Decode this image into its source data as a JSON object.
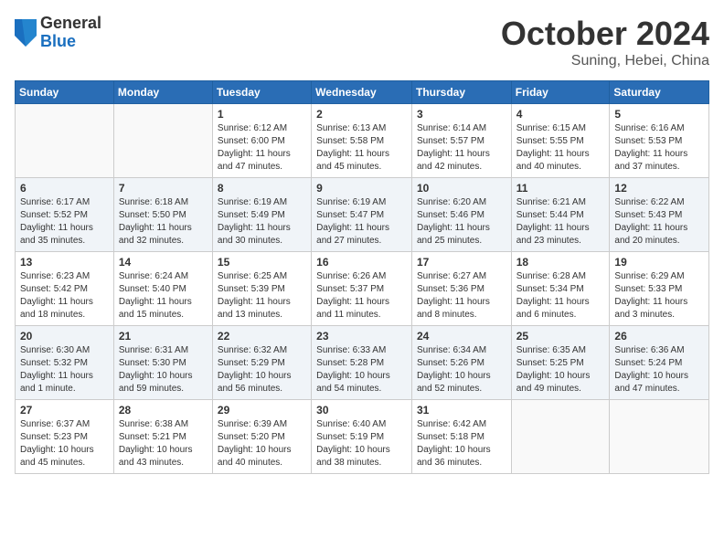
{
  "header": {
    "logo_general": "General",
    "logo_blue": "Blue",
    "month": "October 2024",
    "location": "Suning, Hebei, China"
  },
  "weekdays": [
    "Sunday",
    "Monday",
    "Tuesday",
    "Wednesday",
    "Thursday",
    "Friday",
    "Saturday"
  ],
  "weeks": [
    [
      {
        "day": "",
        "content": ""
      },
      {
        "day": "",
        "content": ""
      },
      {
        "day": "1",
        "content": "Sunrise: 6:12 AM\nSunset: 6:00 PM\nDaylight: 11 hours and 47 minutes."
      },
      {
        "day": "2",
        "content": "Sunrise: 6:13 AM\nSunset: 5:58 PM\nDaylight: 11 hours and 45 minutes."
      },
      {
        "day": "3",
        "content": "Sunrise: 6:14 AM\nSunset: 5:57 PM\nDaylight: 11 hours and 42 minutes."
      },
      {
        "day": "4",
        "content": "Sunrise: 6:15 AM\nSunset: 5:55 PM\nDaylight: 11 hours and 40 minutes."
      },
      {
        "day": "5",
        "content": "Sunrise: 6:16 AM\nSunset: 5:53 PM\nDaylight: 11 hours and 37 minutes."
      }
    ],
    [
      {
        "day": "6",
        "content": "Sunrise: 6:17 AM\nSunset: 5:52 PM\nDaylight: 11 hours and 35 minutes."
      },
      {
        "day": "7",
        "content": "Sunrise: 6:18 AM\nSunset: 5:50 PM\nDaylight: 11 hours and 32 minutes."
      },
      {
        "day": "8",
        "content": "Sunrise: 6:19 AM\nSunset: 5:49 PM\nDaylight: 11 hours and 30 minutes."
      },
      {
        "day": "9",
        "content": "Sunrise: 6:19 AM\nSunset: 5:47 PM\nDaylight: 11 hours and 27 minutes."
      },
      {
        "day": "10",
        "content": "Sunrise: 6:20 AM\nSunset: 5:46 PM\nDaylight: 11 hours and 25 minutes."
      },
      {
        "day": "11",
        "content": "Sunrise: 6:21 AM\nSunset: 5:44 PM\nDaylight: 11 hours and 23 minutes."
      },
      {
        "day": "12",
        "content": "Sunrise: 6:22 AM\nSunset: 5:43 PM\nDaylight: 11 hours and 20 minutes."
      }
    ],
    [
      {
        "day": "13",
        "content": "Sunrise: 6:23 AM\nSunset: 5:42 PM\nDaylight: 11 hours and 18 minutes."
      },
      {
        "day": "14",
        "content": "Sunrise: 6:24 AM\nSunset: 5:40 PM\nDaylight: 11 hours and 15 minutes."
      },
      {
        "day": "15",
        "content": "Sunrise: 6:25 AM\nSunset: 5:39 PM\nDaylight: 11 hours and 13 minutes."
      },
      {
        "day": "16",
        "content": "Sunrise: 6:26 AM\nSunset: 5:37 PM\nDaylight: 11 hours and 11 minutes."
      },
      {
        "day": "17",
        "content": "Sunrise: 6:27 AM\nSunset: 5:36 PM\nDaylight: 11 hours and 8 minutes."
      },
      {
        "day": "18",
        "content": "Sunrise: 6:28 AM\nSunset: 5:34 PM\nDaylight: 11 hours and 6 minutes."
      },
      {
        "day": "19",
        "content": "Sunrise: 6:29 AM\nSunset: 5:33 PM\nDaylight: 11 hours and 3 minutes."
      }
    ],
    [
      {
        "day": "20",
        "content": "Sunrise: 6:30 AM\nSunset: 5:32 PM\nDaylight: 11 hours and 1 minute."
      },
      {
        "day": "21",
        "content": "Sunrise: 6:31 AM\nSunset: 5:30 PM\nDaylight: 10 hours and 59 minutes."
      },
      {
        "day": "22",
        "content": "Sunrise: 6:32 AM\nSunset: 5:29 PM\nDaylight: 10 hours and 56 minutes."
      },
      {
        "day": "23",
        "content": "Sunrise: 6:33 AM\nSunset: 5:28 PM\nDaylight: 10 hours and 54 minutes."
      },
      {
        "day": "24",
        "content": "Sunrise: 6:34 AM\nSunset: 5:26 PM\nDaylight: 10 hours and 52 minutes."
      },
      {
        "day": "25",
        "content": "Sunrise: 6:35 AM\nSunset: 5:25 PM\nDaylight: 10 hours and 49 minutes."
      },
      {
        "day": "26",
        "content": "Sunrise: 6:36 AM\nSunset: 5:24 PM\nDaylight: 10 hours and 47 minutes."
      }
    ],
    [
      {
        "day": "27",
        "content": "Sunrise: 6:37 AM\nSunset: 5:23 PM\nDaylight: 10 hours and 45 minutes."
      },
      {
        "day": "28",
        "content": "Sunrise: 6:38 AM\nSunset: 5:21 PM\nDaylight: 10 hours and 43 minutes."
      },
      {
        "day": "29",
        "content": "Sunrise: 6:39 AM\nSunset: 5:20 PM\nDaylight: 10 hours and 40 minutes."
      },
      {
        "day": "30",
        "content": "Sunrise: 6:40 AM\nSunset: 5:19 PM\nDaylight: 10 hours and 38 minutes."
      },
      {
        "day": "31",
        "content": "Sunrise: 6:42 AM\nSunset: 5:18 PM\nDaylight: 10 hours and 36 minutes."
      },
      {
        "day": "",
        "content": ""
      },
      {
        "day": "",
        "content": ""
      }
    ]
  ]
}
